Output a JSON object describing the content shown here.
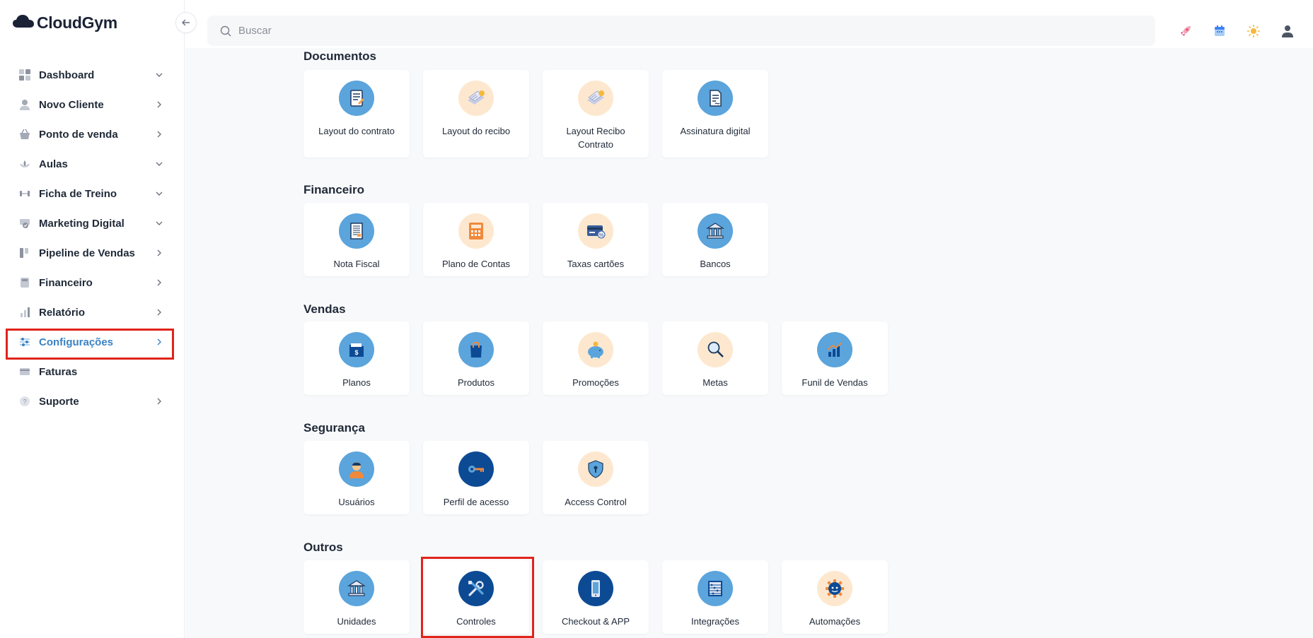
{
  "app": {
    "logo_text": "CloudGym"
  },
  "sidebar": {
    "items": [
      {
        "label": "Dashboard",
        "icon": "grid-icon",
        "chevron": "down"
      },
      {
        "label": "Novo Cliente",
        "icon": "user-icon",
        "chevron": "right"
      },
      {
        "label": "Ponto de venda",
        "icon": "basket-icon",
        "chevron": "right"
      },
      {
        "label": "Aulas",
        "icon": "lotus-icon",
        "chevron": "down"
      },
      {
        "label": "Ficha de Treino",
        "icon": "dumbbell-icon",
        "chevron": "down"
      },
      {
        "label": "Marketing Digital",
        "icon": "megaphone-icon",
        "chevron": "down"
      },
      {
        "label": "Pipeline de Vendas",
        "icon": "kanban-icon",
        "chevron": "right"
      },
      {
        "label": "Financeiro",
        "icon": "wallet-icon",
        "chevron": "right"
      },
      {
        "label": "Relatório",
        "icon": "bar-chart-icon",
        "chevron": "right"
      },
      {
        "label": "Configurações",
        "icon": "sliders-icon",
        "chevron": "right",
        "active": true
      },
      {
        "label": "Faturas",
        "icon": "credit-card-icon",
        "chevron": ""
      },
      {
        "label": "Suporte",
        "icon": "help-icon",
        "chevron": "right"
      }
    ]
  },
  "search": {
    "placeholder": "Buscar"
  },
  "sections": [
    {
      "title": "Documentos",
      "cards": [
        {
          "label": "Layout do contrato",
          "icon": "contract-icon",
          "style": "blue"
        },
        {
          "label": "Layout do recibo",
          "icon": "receipt-icon",
          "style": "peach"
        },
        {
          "label": "Layout Recibo Contrato",
          "icon": "receipt-contract-icon",
          "style": "peach"
        },
        {
          "label": "Assinatura digital",
          "icon": "digital-signature-icon",
          "style": "blue"
        }
      ]
    },
    {
      "title": "Financeiro",
      "cards": [
        {
          "label": "Nota Fiscal",
          "icon": "invoice-icon",
          "style": "blue"
        },
        {
          "label": "Plano de Contas",
          "icon": "calculator-icon",
          "style": "peach"
        },
        {
          "label": "Taxas cartões",
          "icon": "card-fees-icon",
          "style": "peach"
        },
        {
          "label": "Bancos",
          "icon": "bank-icon",
          "style": "blue"
        }
      ]
    },
    {
      "title": "Vendas",
      "cards": [
        {
          "label": "Planos",
          "icon": "plans-folder-icon",
          "style": "blue"
        },
        {
          "label": "Produtos",
          "icon": "shopping-bag-icon",
          "style": "blue"
        },
        {
          "label": "Promoções",
          "icon": "piggy-bank-icon",
          "style": "peach"
        },
        {
          "label": "Metas",
          "icon": "magnifier-icon",
          "style": "peach"
        },
        {
          "label": "Funil de Vendas",
          "icon": "sales-chart-icon",
          "style": "blue"
        }
      ]
    },
    {
      "title": "Segurança",
      "cards": [
        {
          "label": "Usuários",
          "icon": "person-icon",
          "style": "blue"
        },
        {
          "label": "Perfil de acesso",
          "icon": "key-icon",
          "style": "navy"
        },
        {
          "label": "Access Control",
          "icon": "shield-lock-icon",
          "style": "peach"
        }
      ]
    },
    {
      "title": "Outros",
      "cards": [
        {
          "label": "Unidades",
          "icon": "building-icon",
          "style": "blue"
        },
        {
          "label": "Controles",
          "icon": "tools-icon",
          "style": "navy",
          "highlighted": true
        },
        {
          "label": "Checkout & APP",
          "icon": "smartphone-icon",
          "style": "navy"
        },
        {
          "label": "Integrações",
          "icon": "abacus-icon",
          "style": "blue"
        },
        {
          "label": "Automações",
          "icon": "gear-robot-icon",
          "style": "peach"
        }
      ]
    }
  ]
}
